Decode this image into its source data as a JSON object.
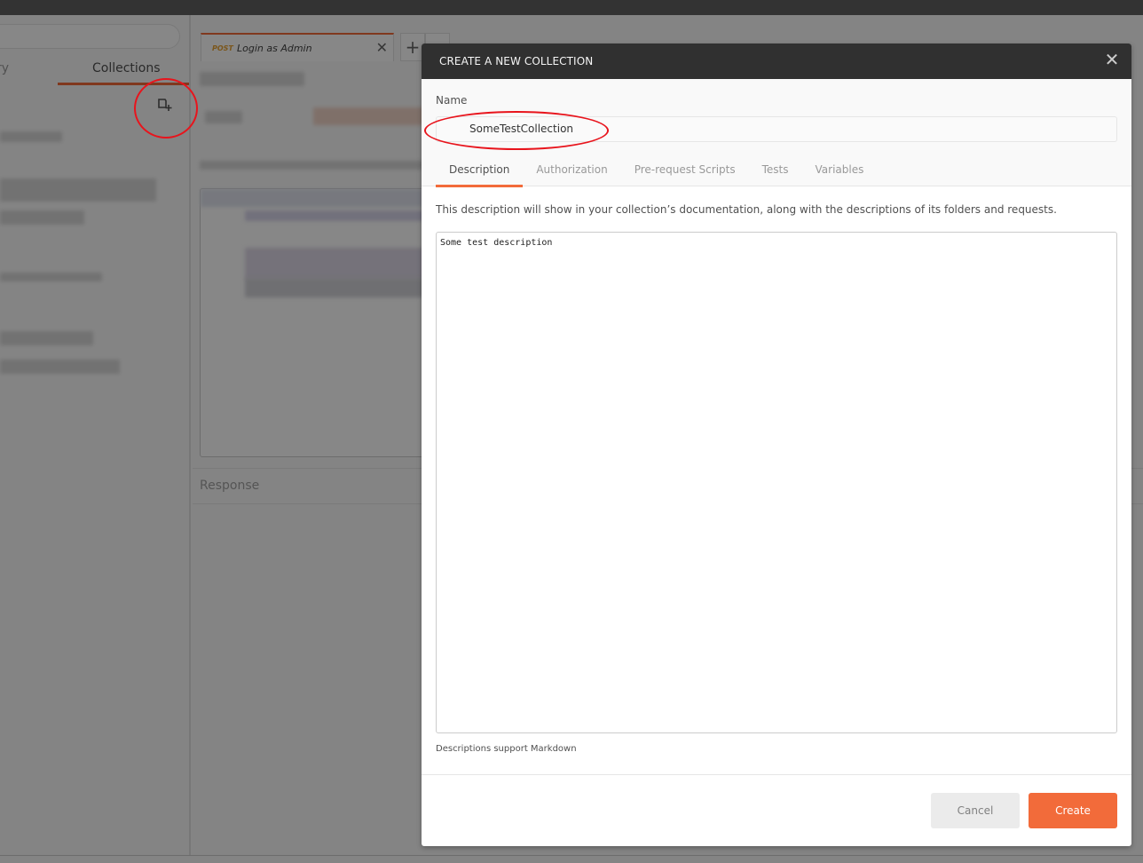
{
  "app": {
    "sidebar": {
      "tabs": [
        {
          "label": "ry",
          "active": false
        },
        {
          "label": "Collections",
          "active": true
        }
      ],
      "new_collection_icon": "folder-plus-icon"
    },
    "request_tab": {
      "method": "POST",
      "title": "Login as Admin",
      "close_glyph": "✕"
    },
    "add_tab_glyph": "+",
    "response_label": "Response"
  },
  "modal": {
    "title": "CREATE A NEW COLLECTION",
    "close_glyph": "✕",
    "name_label": "Name",
    "name_value": "SomeTestCollection",
    "tabs": [
      {
        "label": "Description",
        "active": true
      },
      {
        "label": "Authorization",
        "active": false
      },
      {
        "label": "Pre-request Scripts",
        "active": false
      },
      {
        "label": "Tests",
        "active": false
      },
      {
        "label": "Variables",
        "active": false
      }
    ],
    "description_help": "This description will show in your collection’s documentation, along with the descriptions of its folders and requests.",
    "description_value": "Some test description",
    "markdown_note": "Descriptions support Markdown",
    "cancel_label": "Cancel",
    "create_label": "Create"
  },
  "colors": {
    "accent": "#f26b3a",
    "header_bg": "#303030",
    "annotation_red": "#e8141c",
    "method_post": "#e8a232"
  }
}
